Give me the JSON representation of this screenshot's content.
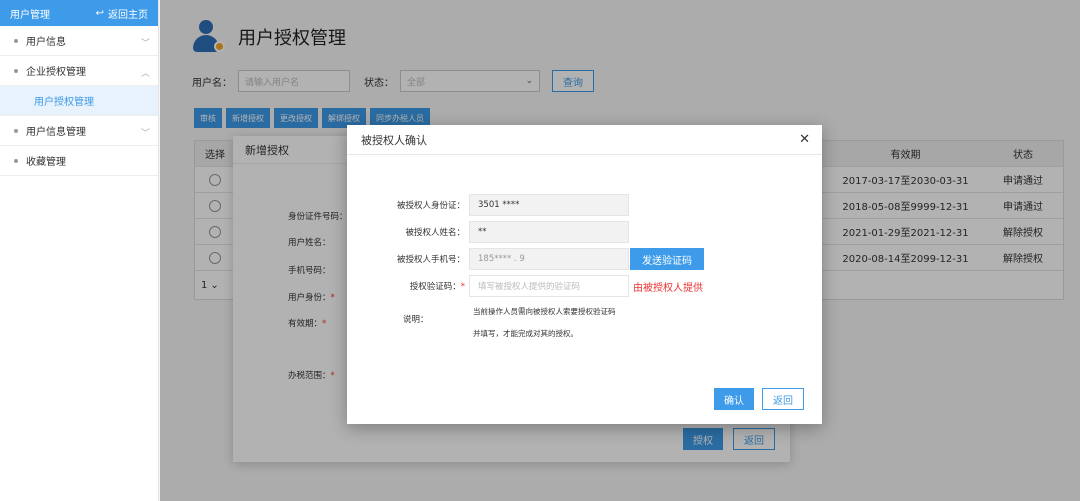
{
  "sidebar": {
    "title": "用户管理",
    "back_label": "返回主页",
    "items": [
      {
        "label": "用户信息"
      },
      {
        "label": "企业授权管理"
      },
      {
        "label": "用户授权管理"
      },
      {
        "label": "用户信息管理"
      },
      {
        "label": "收藏管理"
      }
    ]
  },
  "page": {
    "title": "用户授权管理"
  },
  "filter": {
    "username_label": "用户名：",
    "username_placeholder": "请输入用户名",
    "status_label": "状态：",
    "status_value": "全部",
    "search_label": "查询"
  },
  "toolbar": [
    "审核",
    "新增授权",
    "更改授权",
    "解绑授权",
    "同步办税人员"
  ],
  "table": {
    "headers": {
      "select": "选择",
      "valid": "有效期",
      "status": "状态"
    },
    "rows": [
      {
        "valid": "2017-03-17至2030-03-31",
        "status": "申请通过"
      },
      {
        "valid": "2018-05-08至9999-12-31",
        "status": "申请通过"
      },
      {
        "valid": "2021-01-29至2021-12-31",
        "status": "解除授权"
      },
      {
        "valid": "2020-08-14至2099-12-31",
        "status": "解除授权"
      }
    ],
    "pager": "1"
  },
  "bg_dialog": {
    "title": "新增授权",
    "labels": [
      "身份证件号码：",
      "用户姓名：",
      "手机号码：",
      "用户身份：",
      "有效期：",
      "办税范围："
    ],
    "ok": "授权",
    "back": "返回"
  },
  "dialog": {
    "title": "被授权人确认",
    "id_label": "被授权人身份证：",
    "id_value": "3501  ****",
    "name_label": "被授权人姓名：",
    "name_value": "**",
    "phone_label": "被授权人手机号：",
    "phone_value": "185****  .  9",
    "send_label": "发送验证码",
    "code_label": "授权验证码：",
    "code_placeholder": "填写被授权人提供的验证码",
    "code_hint": "由被授权人提供",
    "explain_label": "说明：",
    "explain_line1": "当前操作人员需向被授权人索要授权验证码",
    "explain_line2": "并填写，才能完成对其的授权。",
    "ok_label": "确认",
    "back_label": "返回"
  }
}
